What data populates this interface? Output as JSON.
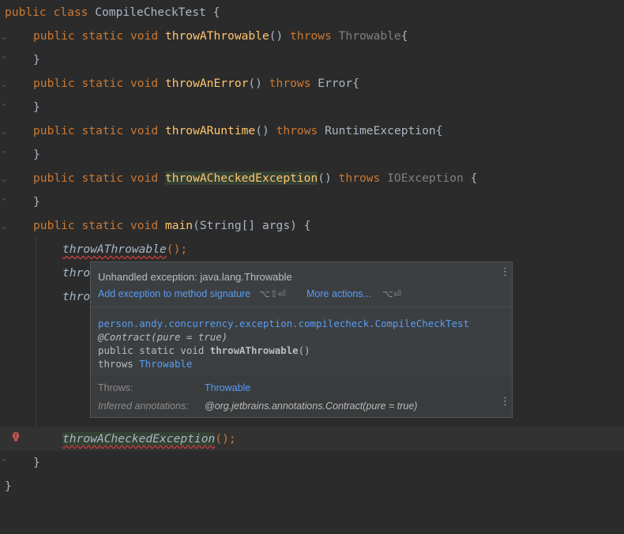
{
  "code": {
    "l1": {
      "kw": "public class",
      "name": "CompileCheckTest",
      "brace": " {"
    },
    "l2": {
      "kw": "public static void",
      "fn": "throwAThrowable",
      "paren": "()",
      "throws": "throws",
      "type": "Throwable",
      "brace": "{"
    },
    "close": "}",
    "l4": {
      "kw": "public static void",
      "fn": "throwAnError",
      "paren": "()",
      "throws": "throws",
      "type": "Error",
      "brace": "{"
    },
    "l6": {
      "kw": "public static void",
      "fn": "throwARuntime",
      "paren": "()",
      "throws": "throws",
      "type": "RuntimeException",
      "brace": "{"
    },
    "l8": {
      "kw": "public static void",
      "fn": "throwACheckedException",
      "paren": "()",
      "throws": "throws",
      "type": "IOException",
      "brace": " {"
    },
    "l10": {
      "kw": "public static void",
      "fn": "main",
      "params": "(String[] args) {"
    },
    "l11": {
      "call": "throwAThrowable",
      "end": "();"
    },
    "l12": {
      "partial": "thro"
    },
    "l13": {
      "partial": "thro"
    },
    "l19": {
      "call": "throwACheckedException",
      "end": "();"
    },
    "l20": "}",
    "l21": "}"
  },
  "popup": {
    "title": "Unhandled exception: java.lang.Throwable",
    "action_primary": "Add exception to method signature",
    "action_primary_shortcut": "⌥⇧⏎",
    "action_more": "More actions...",
    "action_more_shortcut": "⌥⏎",
    "doc_class": "person.andy.concurrency.exception.compilecheck.CompileCheckTest",
    "doc_annotation": "@Contract(pure = true)",
    "doc_signature_prefix": "public static void ",
    "doc_signature_name": "throwAThrowable",
    "doc_signature_suffix": "()",
    "doc_throws_kw": "throws ",
    "doc_throws_type": "Throwable",
    "throws_label": "Throws:",
    "throws_value": "Throwable",
    "inferred_label": "Inferred annotations:",
    "inferred_value": "@org.jetbrains.annotations.Contract(pure = true)",
    "more_icon": "vertical-ellipsis-icon"
  },
  "colors": {
    "background": "#2b2b2b",
    "keyword": "#cc7832",
    "method": "#ffc66d",
    "link": "#589df6",
    "error": "#bc3f3c"
  }
}
